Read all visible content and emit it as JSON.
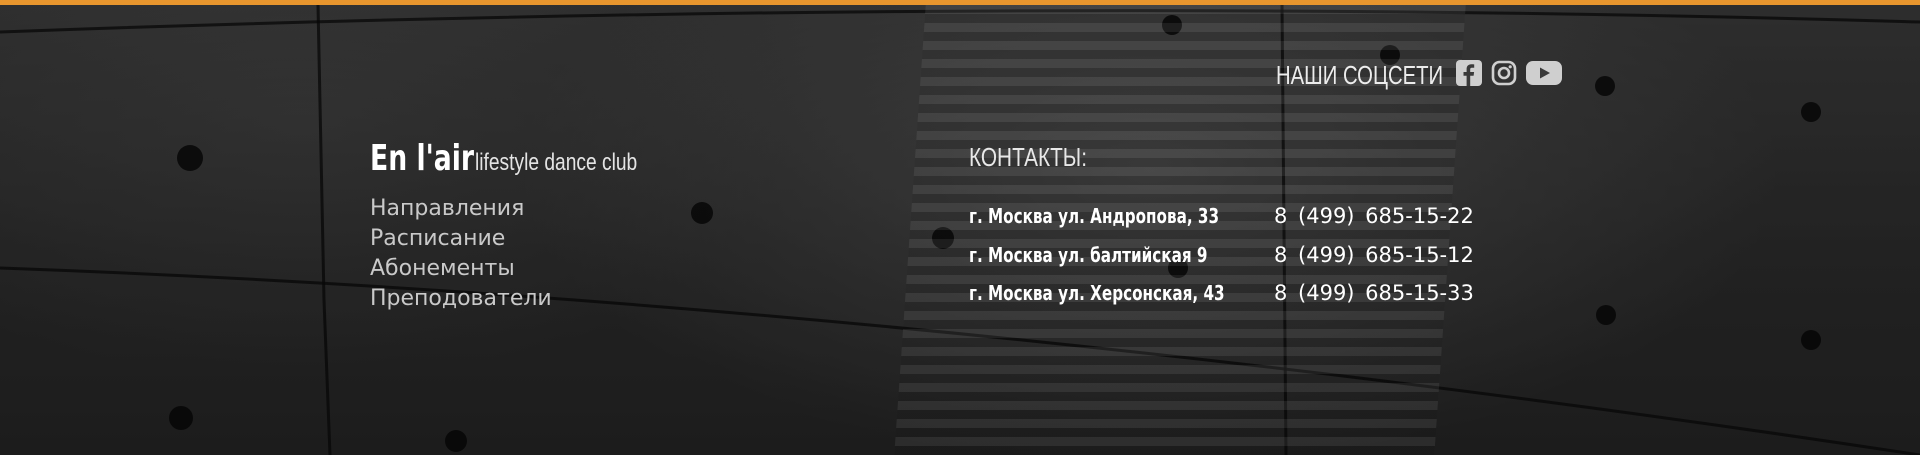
{
  "colors": {
    "accent_bar": "#e8962e",
    "text_primary": "#ffffff",
    "text_secondary": "#c9c9c9"
  },
  "social": {
    "title": "НАШИ СОЦСЕТИ",
    "icons": [
      "facebook-icon",
      "instagram-icon",
      "youtube-icon"
    ]
  },
  "brand": {
    "name": "En l'air",
    "tagline": "lifestyle dance club"
  },
  "nav": {
    "items": [
      {
        "label": "Направления"
      },
      {
        "label": "Расписание"
      },
      {
        "label": "Абонементы"
      },
      {
        "label": "Преподователи"
      }
    ]
  },
  "contacts": {
    "title": "КОНТАКТЫ:",
    "entries": [
      {
        "address": "г. Москва ул. Андропова, 33",
        "phone": "8  (499)  685-15-22"
      },
      {
        "address": "г. Москва ул. балтийская 9",
        "phone": "8  (499)  685-15-12"
      },
      {
        "address": "г. Москва ул.  Херсонская, 43",
        "phone": "8  (499)  685-15-33"
      }
    ]
  }
}
